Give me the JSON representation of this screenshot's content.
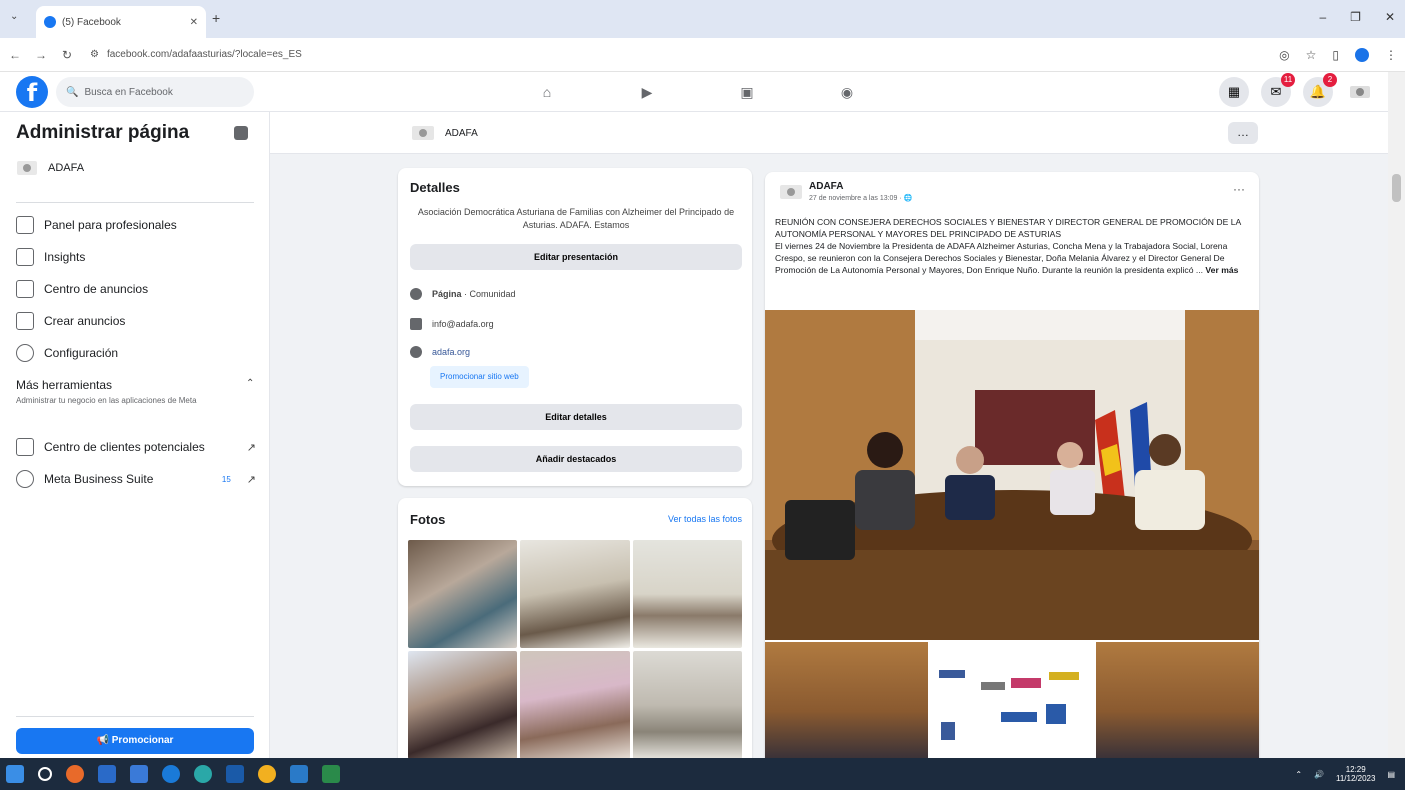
{
  "browser": {
    "tab_title": "(5) Facebook",
    "url": "facebook.com/adafaasturias/?locale=es_ES"
  },
  "facebook": {
    "search_placeholder": "Busca en Facebook",
    "messenger_badge": "11",
    "notifications_badge": "2"
  },
  "sidebar": {
    "title": "Administrar página",
    "page_name": "ADAFA",
    "items": [
      {
        "label": "Panel para profesionales"
      },
      {
        "label": "Insights"
      },
      {
        "label": "Centro de anuncios"
      },
      {
        "label": "Crear anuncios"
      },
      {
        "label": "Configuración"
      }
    ],
    "more_tools_title": "Más herramientas",
    "more_tools_sub": "Administrar tu negocio en las aplicaciones de Meta",
    "tools": [
      {
        "label": "Centro de clientes potenciales"
      },
      {
        "label": "Meta Business Suite",
        "badge": "15"
      }
    ],
    "promote_label": "Promocionar"
  },
  "page_header": {
    "name": "ADAFA"
  },
  "details": {
    "title": "Detalles",
    "description": "Asociación Democrática Asturiana de Familias con Alzheimer del Principado de Asturias. ADAFA. Estamos",
    "edit_intro": "Editar presentación",
    "category_label": "Página",
    "category_value": "Comunidad",
    "email": "info@adafa.org",
    "website": "adafa.org",
    "promote_site": "Promocionar sitio web",
    "edit_details": "Editar detalles",
    "add_featured": "Añadir destacados"
  },
  "photos": {
    "title": "Fotos",
    "see_all": "Ver todas las fotos"
  },
  "post": {
    "author": "ADAFA",
    "date": "27 de noviembre a las 13:09",
    "heading": "REUNIÓN CON CONSEJERA DERECHOS SOCIALES Y BIENESTAR Y DIRECTOR GENERAL DE PROMOCIÓN DE LA AUTONOMÍA PERSONAL Y MAYORES DEL PRINCIPADO DE ASTURIAS",
    "body": "El viernes 24 de Noviembre la Presidenta de ADAFA Alzheimer Asturias, Concha Mena y la Trabajadora Social, Lorena Crespo, se reunieron con la Consejera Derechos Sociales y Bienestar, Doña Melania Álvarez y el Director General De Promoción de La Autonomía Personal y Mayores, Don Enrique Nuño. Durante la reunión la presidenta explicó ...",
    "see_more": "Ver más"
  },
  "taskbar": {
    "time": "12:29",
    "date": "11/12/2023"
  },
  "colors": {
    "brand": "#1877f2",
    "badge": "#e41e3f"
  }
}
